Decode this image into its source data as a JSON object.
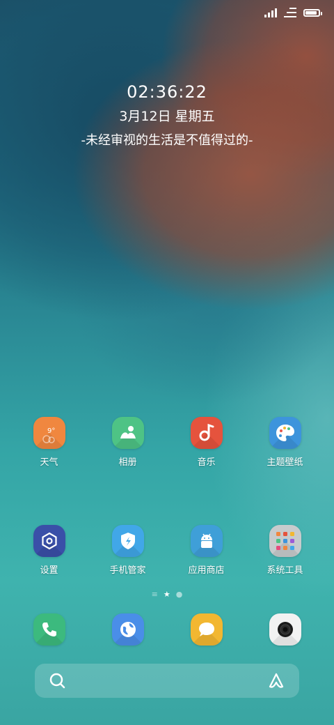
{
  "clock": {
    "time": "02:36:22",
    "date": "3月12日 星期五",
    "motto": "-未经审视的生活是不值得过的-"
  },
  "status_bar": {
    "icons": [
      "signal-icon",
      "data-icon",
      "battery-icon"
    ],
    "battery_level": 0.9
  },
  "apps": [
    {
      "label": "天气",
      "icon": "weather-icon",
      "color": "#f0873f",
      "badge": "9°"
    },
    {
      "label": "相册",
      "icon": "gallery-icon",
      "color": "#4ec385"
    },
    {
      "label": "音乐",
      "icon": "music-icon",
      "color": "#e5533d"
    },
    {
      "label": "主题壁纸",
      "icon": "theme-icon",
      "color": "#3d94dc"
    },
    {
      "label": "设置",
      "icon": "settings-icon",
      "color": "#3a4fa8"
    },
    {
      "label": "手机管家",
      "icon": "security-icon",
      "color": "#41a7e8"
    },
    {
      "label": "应用商店",
      "icon": "android-icon",
      "color": "#3f9fd8"
    },
    {
      "label": "系统工具",
      "icon": "folder-icon",
      "color": "#c7cbcd"
    }
  ],
  "page_indicator": {
    "pages": 3,
    "current": 2
  },
  "dock": [
    {
      "icon": "phone-icon",
      "color": "#3cba7e"
    },
    {
      "icon": "browser-icon",
      "color": "#4a8ee8"
    },
    {
      "icon": "message-icon",
      "color": "#f2b731"
    },
    {
      "icon": "camera-icon",
      "color": "#f2f2f2"
    }
  ],
  "search": {
    "icons": [
      "search-icon",
      "assistant-icon"
    ]
  }
}
